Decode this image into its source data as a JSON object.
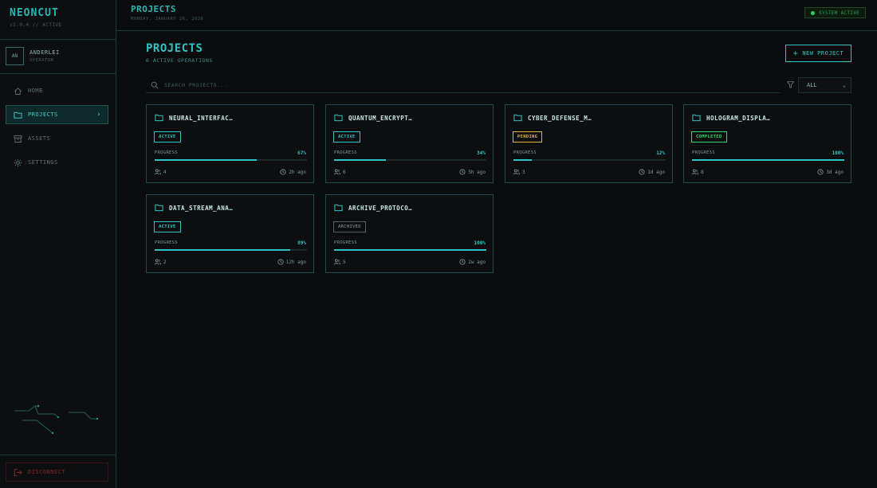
{
  "app": {
    "brand": "NEONCUT",
    "version": "v2.0.4 // ACTIVE"
  },
  "user": {
    "initials": "AN",
    "name": "ANDERLEI",
    "role": "OPERATOR"
  },
  "nav": [
    {
      "label": "HOME",
      "icon": "home-icon"
    },
    {
      "label": "PROJECTS",
      "icon": "folder-icon",
      "active": true
    },
    {
      "label": "ASSETS",
      "icon": "archive-box-icon"
    },
    {
      "label": "SETTINGS",
      "icon": "gear-icon"
    }
  ],
  "disconnect_label": "DISCONNECT",
  "header": {
    "title": "PROJECTS",
    "date": "MONDAY, JANUARY 26, 2026",
    "status": "SYSTEM ACTIVE"
  },
  "main": {
    "title": "PROJECTS",
    "subtitle": "6 ACTIVE OPERATIONS",
    "new_button": "NEW PROJECT",
    "search_placeholder": "SEARCH PROJECTS...",
    "filter_value": "ALL",
    "progress_label": "PROGRESS"
  },
  "projects": [
    {
      "name": "NEURAL_INTERFAC…",
      "status": "ACTIVE",
      "progress": "67%",
      "progress_value": 67,
      "members": "4",
      "updated": "2h ago"
    },
    {
      "name": "QUANTUM_ENCRYPT…",
      "status": "ACTIVE",
      "progress": "34%",
      "progress_value": 34,
      "members": "6",
      "updated": "5h ago"
    },
    {
      "name": "CYBER_DEFENSE_M…",
      "status": "PENDING",
      "progress": "12%",
      "progress_value": 12,
      "members": "3",
      "updated": "1d ago"
    },
    {
      "name": "HOLOGRAM_DISPLA…",
      "status": "COMPLETED",
      "progress": "100%",
      "progress_value": 100,
      "members": "8",
      "updated": "3d ago"
    },
    {
      "name": "DATA_STREAM_ANA…",
      "status": "ACTIVE",
      "progress": "89%",
      "progress_value": 89,
      "members": "2",
      "updated": "12h ago"
    },
    {
      "name": "ARCHIVE_PROTOCO…",
      "status": "ARCHIVED",
      "progress": "100%",
      "progress_value": 100,
      "members": "5",
      "updated": "2w ago"
    }
  ],
  "colors": {
    "accent": "#2ec4c4",
    "pending": "#e0b33a",
    "completed": "#39d86a",
    "archived": "#8a9898",
    "danger": "#8a2222",
    "background": "#0b0c0d"
  }
}
